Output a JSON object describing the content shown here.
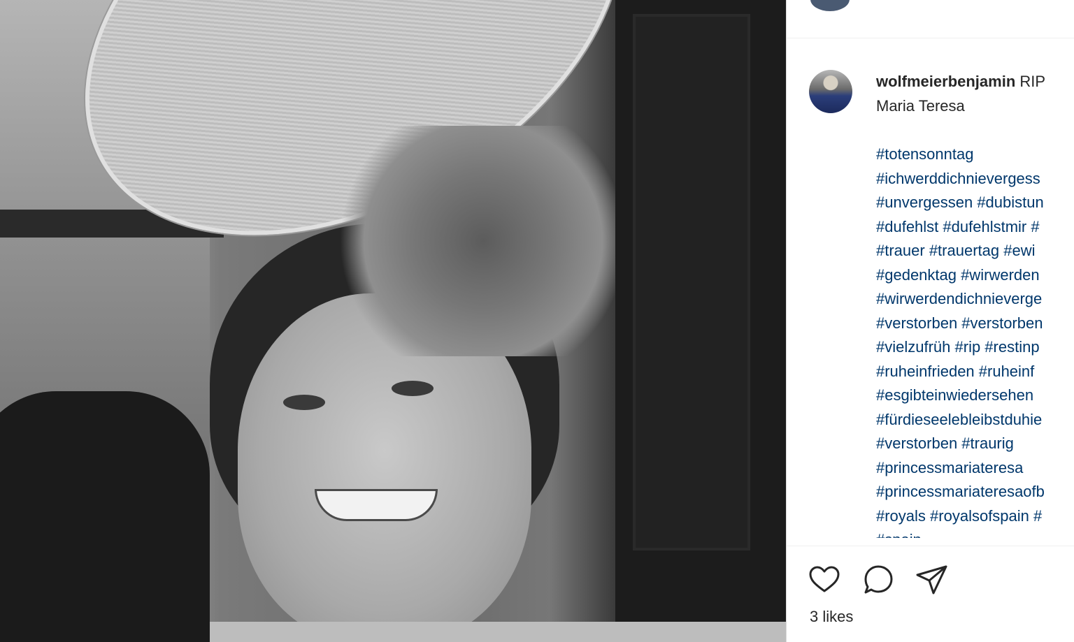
{
  "post": {
    "username": "wolfmeierbenjamin",
    "caption_line1": "RIP",
    "caption_line2": "Maria Teresa",
    "hashtag_lines": [
      "#totensonntag",
      "#ichwerddichnievergess",
      "#unvergessen #dubistun",
      "#dufehlst #dufehlstmir #",
      "#trauer #trauertag #ewi",
      "#gedenktag #wirwerden",
      "#wirwerdendichnieverge",
      "#verstorben #verstorben",
      "#vielzufrüh #rip #restinp",
      "#ruheinfrieden #ruheinf",
      "#esgibteinwiedersehen",
      "#fürdieseelebleibstduhie",
      "#verstorben #traurig",
      "#princessmariateresa",
      "#princessmariateresaofb",
      "#royals #royalsofspain #",
      "#spain"
    ],
    "likes": "3 likes"
  },
  "icons": {
    "like": "heart-icon",
    "comment": "comment-icon",
    "share": "paper-plane-icon"
  },
  "colors": {
    "text": "#262626",
    "hashtag": "#00376b",
    "divider": "#efefef"
  }
}
